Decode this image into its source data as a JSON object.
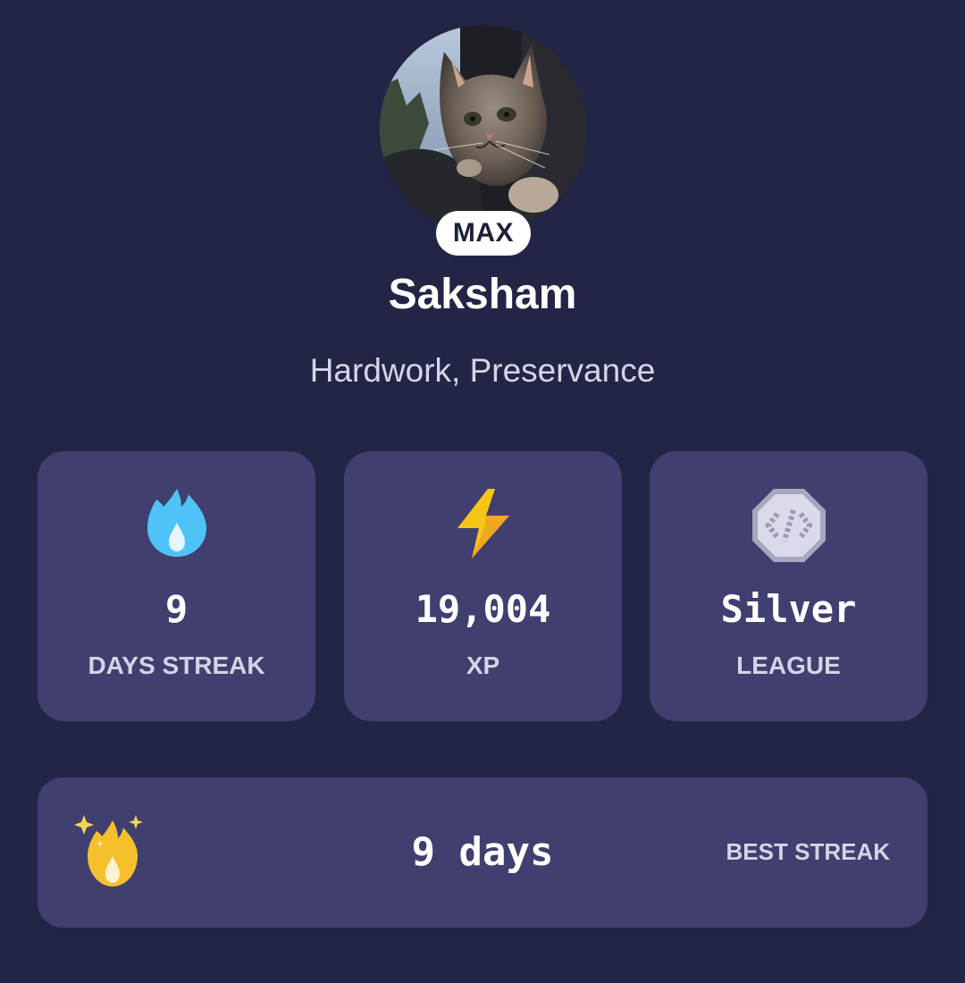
{
  "profile": {
    "plan_badge": "MAX",
    "name": "Saksham",
    "bio": "Hardwork, Preservance"
  },
  "stats": [
    {
      "value": "9",
      "label": "DAYS STREAK",
      "icon": "flame-icon"
    },
    {
      "value": "19,004",
      "label": "XP",
      "icon": "lightning-bolt-icon"
    },
    {
      "value": "Silver",
      "label": "LEAGUE",
      "icon": "silver-league-badge-icon"
    }
  ],
  "best_streak": {
    "value": "9 days",
    "label": "BEST STREAK",
    "icon": "sparkle-flame-icon"
  },
  "colors": {
    "background": "#232546",
    "card": "#403f6f",
    "streak_flame": "#4fc3f7",
    "xp_bolt": "#f5c518",
    "best_flame": "#f6c02d"
  }
}
